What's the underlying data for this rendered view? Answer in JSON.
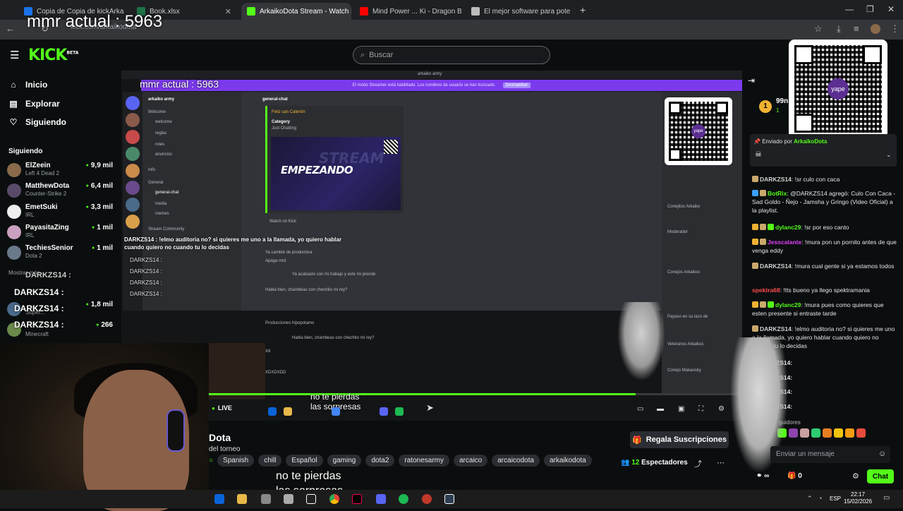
{
  "browser": {
    "tabs": [
      {
        "label": "Copia de Copia de kickArkaiko",
        "color": "#1a73e8"
      },
      {
        "label": "Book.xlsx",
        "color": "#1e7145"
      },
      {
        "label": "ArkaikoDota Stream - Watch Li",
        "color": "#53fc18"
      },
      {
        "label": "Mind Power ... Ki - Dragon Ball",
        "color": "#ff0000"
      },
      {
        "label": "El mejor software para pote",
        "color": "#bbbbbb"
      }
    ],
    "new_tab": "+",
    "url": "kick.com/arkaikodota"
  },
  "overlay": {
    "mmr_big": "mmr actual : 5963",
    "mmr_small": "mmr actual : 5963",
    "darkz_lines": [
      "DARKZS14 :",
      "DARKZS14 :",
      "DARKZS14 :",
      "DARKZS14 :"
    ]
  },
  "kick": {
    "logo": "KICK",
    "logo_sup": "BETA",
    "search_placeholder": "Buscar"
  },
  "sidebar": {
    "nav": [
      {
        "label": "Inicio",
        "icon": "home-icon"
      },
      {
        "label": "Explorar",
        "icon": "compass-icon"
      },
      {
        "label": "Siguiendo",
        "icon": "heart-icon"
      }
    ],
    "following_title": "Siguiendo",
    "following": [
      {
        "name": "ElZeein",
        "category": "Left 4 Dead 2",
        "viewers": "9,9 mil",
        "color": "#8a6a4a"
      },
      {
        "name": "MatthewDota",
        "category": "Counter-Strike 2",
        "viewers": "6,4 mil",
        "color": "#5a4a6a"
      },
      {
        "name": "EmetSuki",
        "category": "IRL",
        "viewers": "3,3 mil",
        "color": "#eeeeee"
      },
      {
        "name": "PayasitaZing",
        "category": "IRL",
        "viewers": "1 mil",
        "color": "#c9a0c0"
      },
      {
        "name": "TechiesSenior",
        "category": "Dota 2",
        "viewers": "1 mil",
        "color": "#6a7a8a"
      }
    ],
    "show_more": "Mostrar más",
    "more_following": [
      {
        "category": "Super...",
        "viewers": "1,8 mil"
      },
      {
        "category": "Minecraft",
        "viewers": "266"
      }
    ]
  },
  "discord": {
    "server_name": "arkaiko army",
    "streamer_banner": "El modo Streamer está habilitado. Los nombres de usuario se han truncado.",
    "streamer_disable": "Deshabilitar",
    "channels": [
      "Welcome",
      "welcome",
      "reglas",
      "roles",
      "anuncios",
      "Info",
      "General",
      "general-chat",
      "media",
      "memes",
      "Stream Community"
    ],
    "header_channel": "general-chat",
    "embed_user": "Feliz san Calentin",
    "embed_category_label": "Category",
    "embed_category": "Just Chatting",
    "embed_image_text": "EMPEZANDO",
    "embed_image_bg_text": "STREAM",
    "watch_on_kick": "Watch on Kick",
    "messages": [
      "Ya cambié de productora",
      "Apaga mrd",
      "Ya acabaste con mi trabajo y este mi prende",
      "Habla bien, chambeas con chechito mi rey?",
      "Producciones hipopotamo",
      "Habla bien, chambeas con chechito mi rey?",
      "Xd",
      "XDXDXDD"
    ],
    "member_groups": [
      "Conejitos Arkaiko",
      "Moderador",
      "Conejos Arkaikos",
      "Payaso en su lazo de",
      "Veteranos Arkaikos",
      "Conejo Makaosky"
    ]
  },
  "video": {
    "chat_overlay_line": "DARKZS14 : !elmo auditoria no? si quieres me uno a la llamada, yo quiero hablar cuando quiero no cuando tu lo decidas",
    "overlay_darkz": [
      "DARKZS14 :",
      "DARKZS14 :",
      "DARKZS14 :",
      "DARKZS14 :"
    ],
    "caption_line1": "no te pierdas",
    "caption_line2": "las sorpresas",
    "live_label": "LIVE",
    "progress": 0.8
  },
  "stream_info": {
    "title": "Dota",
    "subtitle": "del torneo",
    "tags": [
      "Spanish",
      "chill",
      "Español",
      "gaming",
      "dota2",
      "ratonesarmy",
      "arcaico",
      "arcaicodota",
      "arkaikodota"
    ],
    "gift_button": "Regala Suscripciones",
    "viewers_count": "12",
    "viewers_label": "Espectadores",
    "caption_line1": "no te pierdas",
    "caption_line2": "las sorpresas"
  },
  "chat": {
    "top_count": "99n",
    "top_count2": "1",
    "pinned_by": "Enviado por",
    "pinned_user": "ArkaikoDota",
    "messages": [
      {
        "user": "DARKZS14",
        "color": "#d0d0d0",
        "text": ": !sr culo con caca"
      },
      {
        "user": "BotRix",
        "color": "#53fc18",
        "text": ": @DARKZS14 agregó: Culo Con Caca - Sad Goldo - Ñejo - Jamsha y Gringo (Video Oficial) a la playlist."
      },
      {
        "user": "dylanc29",
        "color": "#53fc18",
        "text": ": !sr por eso canto"
      },
      {
        "user": "Jesscalante",
        "color": "#e040fb",
        "text": ": !mura pon un pornito antes de que venga eddy"
      },
      {
        "user": "DARKZS14",
        "color": "#d0d0d0",
        "text": ": !mura cual gente si ya estamos todos"
      },
      {
        "user": "spektra68",
        "color": "#ff4d4d",
        "text": ": !tts bueno ya llego spektramania"
      },
      {
        "user": "dylanc29",
        "color": "#53fc18",
        "text": ": !mura pues como quieres que esten presente si entraste tarde"
      },
      {
        "user": "DARKZS14",
        "color": "#d0d0d0",
        "text": ": !elmo auditoria no? si quieres me uno a la llamada, yo quiero hablar cuando quiero no cuando tu lo decidas"
      }
    ],
    "short_lines": [
      "ZS14:",
      "ZS14:",
      "ZS14:",
      "ZS14:"
    ],
    "followers_label": "guidores",
    "input_placeholder": "Enviar un mensaje",
    "points": "∞",
    "gifts": "0",
    "send_button": "Chat"
  },
  "taskbar": {
    "lang": "ESP",
    "time": "22:17",
    "date": "15/02/2026"
  },
  "colors": {
    "kick_green": "#53fc18",
    "discord_purple": "#7c3aed",
    "background": "#0b0e0f"
  }
}
